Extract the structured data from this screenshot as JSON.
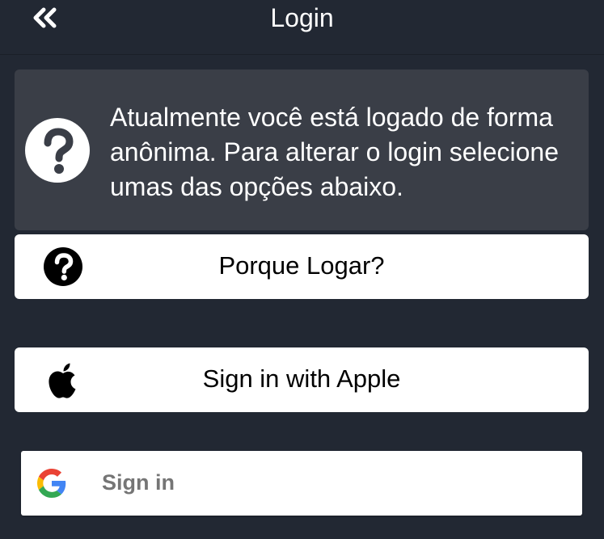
{
  "header": {
    "title": "Login",
    "back_icon": "double-chevron-left-icon"
  },
  "info": {
    "icon": "question-circle-icon",
    "message": "Atualmente você está logado de forma anônima. Para alterar o login selecione umas das opções abaixo."
  },
  "buttons": {
    "why_login": {
      "label": "Porque Logar?",
      "icon": "question-circle-icon"
    },
    "apple": {
      "label": "Sign in with Apple",
      "icon": "apple-logo-icon"
    },
    "google": {
      "label": "Sign in",
      "icon": "google-logo-icon"
    }
  },
  "colors": {
    "background": "#222833",
    "panel": "#3a3e47",
    "button_bg": "#ffffff",
    "google_label": "#757575"
  }
}
